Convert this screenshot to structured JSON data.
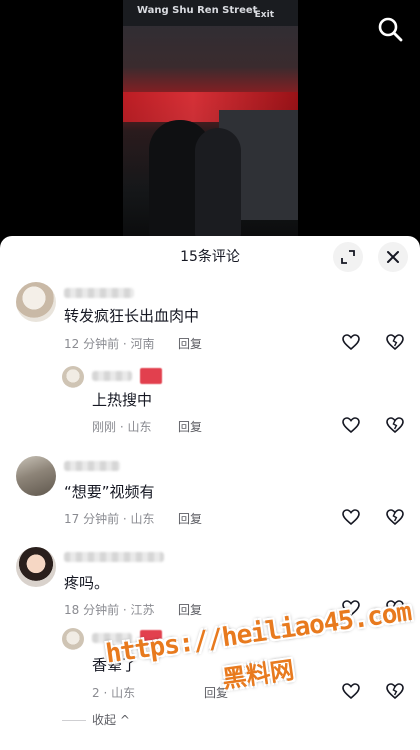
{
  "video": {
    "sign_text": "Wang Shu Ren Street",
    "exit_text": "Exit"
  },
  "panel": {
    "title": "15条评论"
  },
  "comments": [
    {
      "text": "转发疯狂长出血肉中",
      "time": "12 分钟前",
      "location": "河南",
      "reply_label": "回复"
    },
    {
      "text": "上热搜中",
      "time": "刚刚",
      "location": "山东",
      "reply_label": "回复"
    },
    {
      "text": "“想要”视频有",
      "time": "17 分钟前",
      "location": "山东",
      "reply_label": "回复"
    },
    {
      "text": "疼吗。",
      "time": "18 分钟前",
      "location": "江苏",
      "reply_label": "回复"
    },
    {
      "text": "香晕了",
      "time": "2",
      "location": "山东",
      "reply_label": "回复"
    }
  ],
  "meta_separator": " · ",
  "collapse_label": "收起",
  "collapse_chevron": "^",
  "watermark": {
    "url": "https://heiliao45.com",
    "name": "黑料网"
  },
  "colors": {
    "text": "#161823",
    "meta": "#8a8b91",
    "watermark": "#e87a1e"
  }
}
